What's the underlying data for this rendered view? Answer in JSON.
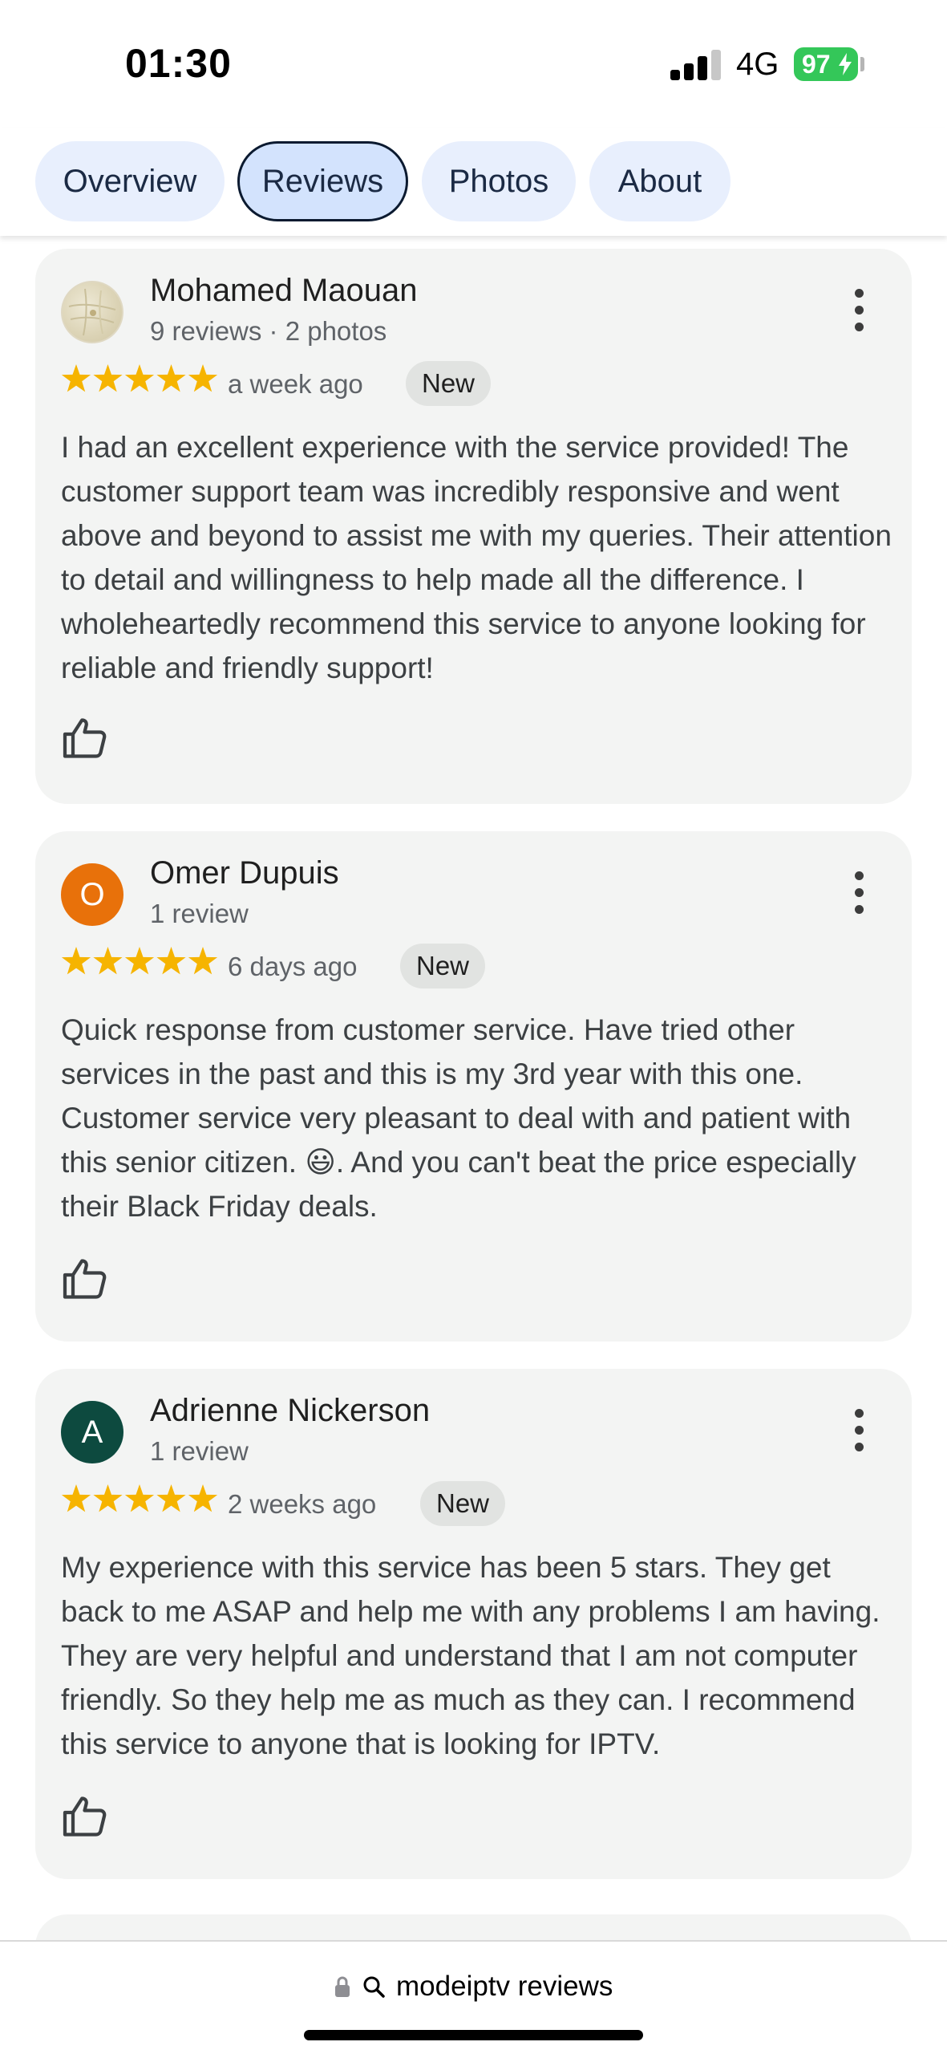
{
  "status_bar": {
    "time": "01:30",
    "network": "4G",
    "battery": "97",
    "icons": [
      "signal-bars-icon",
      "charging-bolt-icon"
    ]
  },
  "tabs": [
    {
      "label": "Overview",
      "active": false
    },
    {
      "label": "Reviews",
      "active": true
    },
    {
      "label": "Photos",
      "active": false
    },
    {
      "label": "About",
      "active": false
    }
  ],
  "reviews": [
    {
      "name": "Mohamed Maouan",
      "meta": "9 reviews · 2 photos",
      "avatar_letter": "",
      "rating": 5,
      "time_ago": "a week ago",
      "badge": "New",
      "text": "I had an excellent experience with the service provided! The customer support team was incredibly responsive and went above and beyond to assist me with my queries. Their attention to detail and willingness to help made all the difference. I wholeheartedly recommend this service to anyone looking for reliable and friendly support!"
    },
    {
      "name": "Omer Dupuis",
      "meta": "1 review",
      "avatar_letter": "O",
      "rating": 5,
      "time_ago": "6 days ago",
      "badge": "New",
      "text": "Quick response from customer service. Have tried other services in the past and this is my 3rd year with this one. Customer service very pleasant to deal with and patient with this senior citizen. 😃. And you can't beat the price especially their Black Friday deals."
    },
    {
      "name": "Adrienne Nickerson",
      "meta": "1 review",
      "avatar_letter": "A",
      "rating": 5,
      "time_ago": "2 weeks ago",
      "badge": "New",
      "text": "My experience with this service has been 5 stars. They get back to me ASAP and help me with any problems I am having. They are very helpful and understand that I am not computer friendly. So they help me as much as they can. I recommend this service to anyone that is looking for IPTV."
    }
  ],
  "bottom_bar": {
    "url_text": "modeiptv reviews",
    "icons": [
      "lock-icon",
      "search-icon"
    ]
  },
  "colors": {
    "star": "#f6b400",
    "avatar_omer": "#e8710a",
    "avatar_adrienne": "#0d4a3f",
    "tab_bg": "#e8effd",
    "tab_active_bg": "#d3e3fd",
    "card_bg": "#f3f4f3",
    "battery": "#34c759"
  }
}
